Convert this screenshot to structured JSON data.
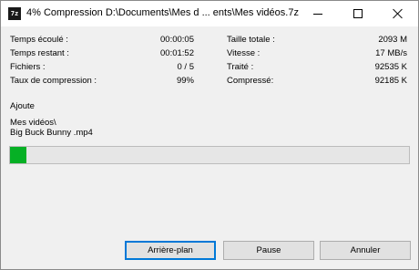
{
  "window": {
    "icon_text": "7z",
    "title": "4% Compression D:\\Documents\\Mes d ... ents\\Mes vidéos.7z"
  },
  "stats_left": [
    {
      "label": "Temps écoulé :",
      "value": "00:00:05"
    },
    {
      "label": "Temps restant :",
      "value": "00:01:52"
    },
    {
      "label": "Fichiers :",
      "value": "0 / 5"
    },
    {
      "label": "Taux de compression :",
      "value": "99%"
    }
  ],
  "stats_right": [
    {
      "label": "Taille totale :",
      "value": "2093 M"
    },
    {
      "label": "Vitesse :",
      "value": "17 MB/s"
    },
    {
      "label": "Traité :",
      "value": "92535 K"
    },
    {
      "label": "Compressé:",
      "value": "92185 K"
    }
  ],
  "operation": {
    "label": "Ajoute",
    "folder": "Mes vidéos\\",
    "file": "Big Buck Bunny .mp4"
  },
  "progress": {
    "percent": 4,
    "color": "#06b025"
  },
  "buttons": {
    "background": "Arrière-plan",
    "pause": "Pause",
    "cancel": "Annuler"
  }
}
